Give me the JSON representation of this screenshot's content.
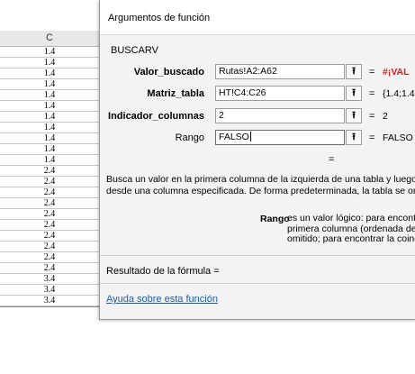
{
  "sheet": {
    "column_header": "C",
    "cells": [
      "1.4",
      "1.4",
      "1.4",
      "1.4",
      "1.4",
      "1.4",
      "1.4",
      "1.4",
      "1.4",
      "1.4",
      "1.4",
      "2.4",
      "2.4",
      "2.4",
      "2.4",
      "2.4",
      "2.4",
      "2.4",
      "2.4",
      "2.4",
      "2.4",
      "3.4",
      "3.4",
      "3.4"
    ]
  },
  "dialog": {
    "title": "Argumentos de función",
    "function_name": "BUSCARV",
    "args": [
      {
        "label": "Valor_buscado",
        "value": "Rutas!A2:A62",
        "result": "#¡VAL",
        "error": true,
        "bold": true
      },
      {
        "label": "Matriz_tabla",
        "value": "HT!C4:C26",
        "result": "{1.4;1.4",
        "error": false,
        "bold": true
      },
      {
        "label": "Indicador_columnas",
        "value": "2",
        "result": "2",
        "error": false,
        "bold": true
      },
      {
        "label": "Rango",
        "value": "FALSO",
        "result": "FALSO",
        "error": false,
        "bold": false
      }
    ],
    "equals": "=",
    "shrink_glyph": "⭱",
    "description_lines": [
      "Busca un valor en la primera columna de la izquierda de una tabla y luego d",
      "desde una columna especificada. De forma predeterminada, la tabla se ord"
    ],
    "arg_help_name": "Rango",
    "arg_help_lines": [
      "es un valor lógico: para encontrar l",
      "primera columna (ordenada de for",
      "omitido; para encontrar la coincide"
    ],
    "result_label": "Resultado de la fórmula =",
    "help_link": "Ayuda sobre esta función"
  },
  "colors": {
    "error": "#d21f1f",
    "link": "#1a5fb4"
  }
}
